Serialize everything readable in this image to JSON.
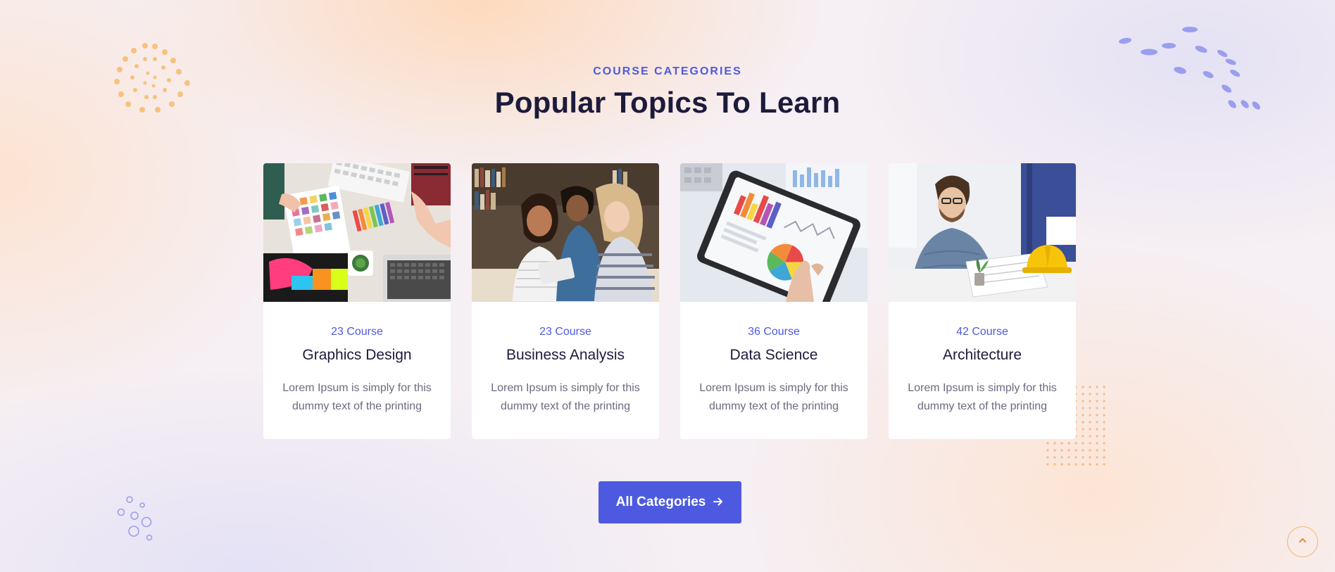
{
  "section": {
    "eyebrow": "COURSE CATEGORIES",
    "heading": "Popular Topics To Learn"
  },
  "categories": [
    {
      "count": "23 Course",
      "title": "Graphics Design",
      "description": "Lorem Ipsum is simply for this dummy text of the printing"
    },
    {
      "count": "23 Course",
      "title": "Business Analysis",
      "description": "Lorem Ipsum is simply for this dummy text of the printing"
    },
    {
      "count": "36 Course",
      "title": "Data Science",
      "description": "Lorem Ipsum is simply for this dummy text of the printing"
    },
    {
      "count": "42 Course",
      "title": "Architecture",
      "description": "Lorem Ipsum is simply for this dummy text of the printing"
    }
  ],
  "cta": {
    "label": "All Categories",
    "icon": "arrow-right-icon"
  },
  "scroll_top": {
    "icon": "chevron-up-icon"
  },
  "colors": {
    "accent": "#4d5ae0",
    "heading": "#1d1b3c",
    "body_text": "#6b6a80",
    "decor_orange": "#f7b86a",
    "decor_purple": "#8f93ea"
  }
}
